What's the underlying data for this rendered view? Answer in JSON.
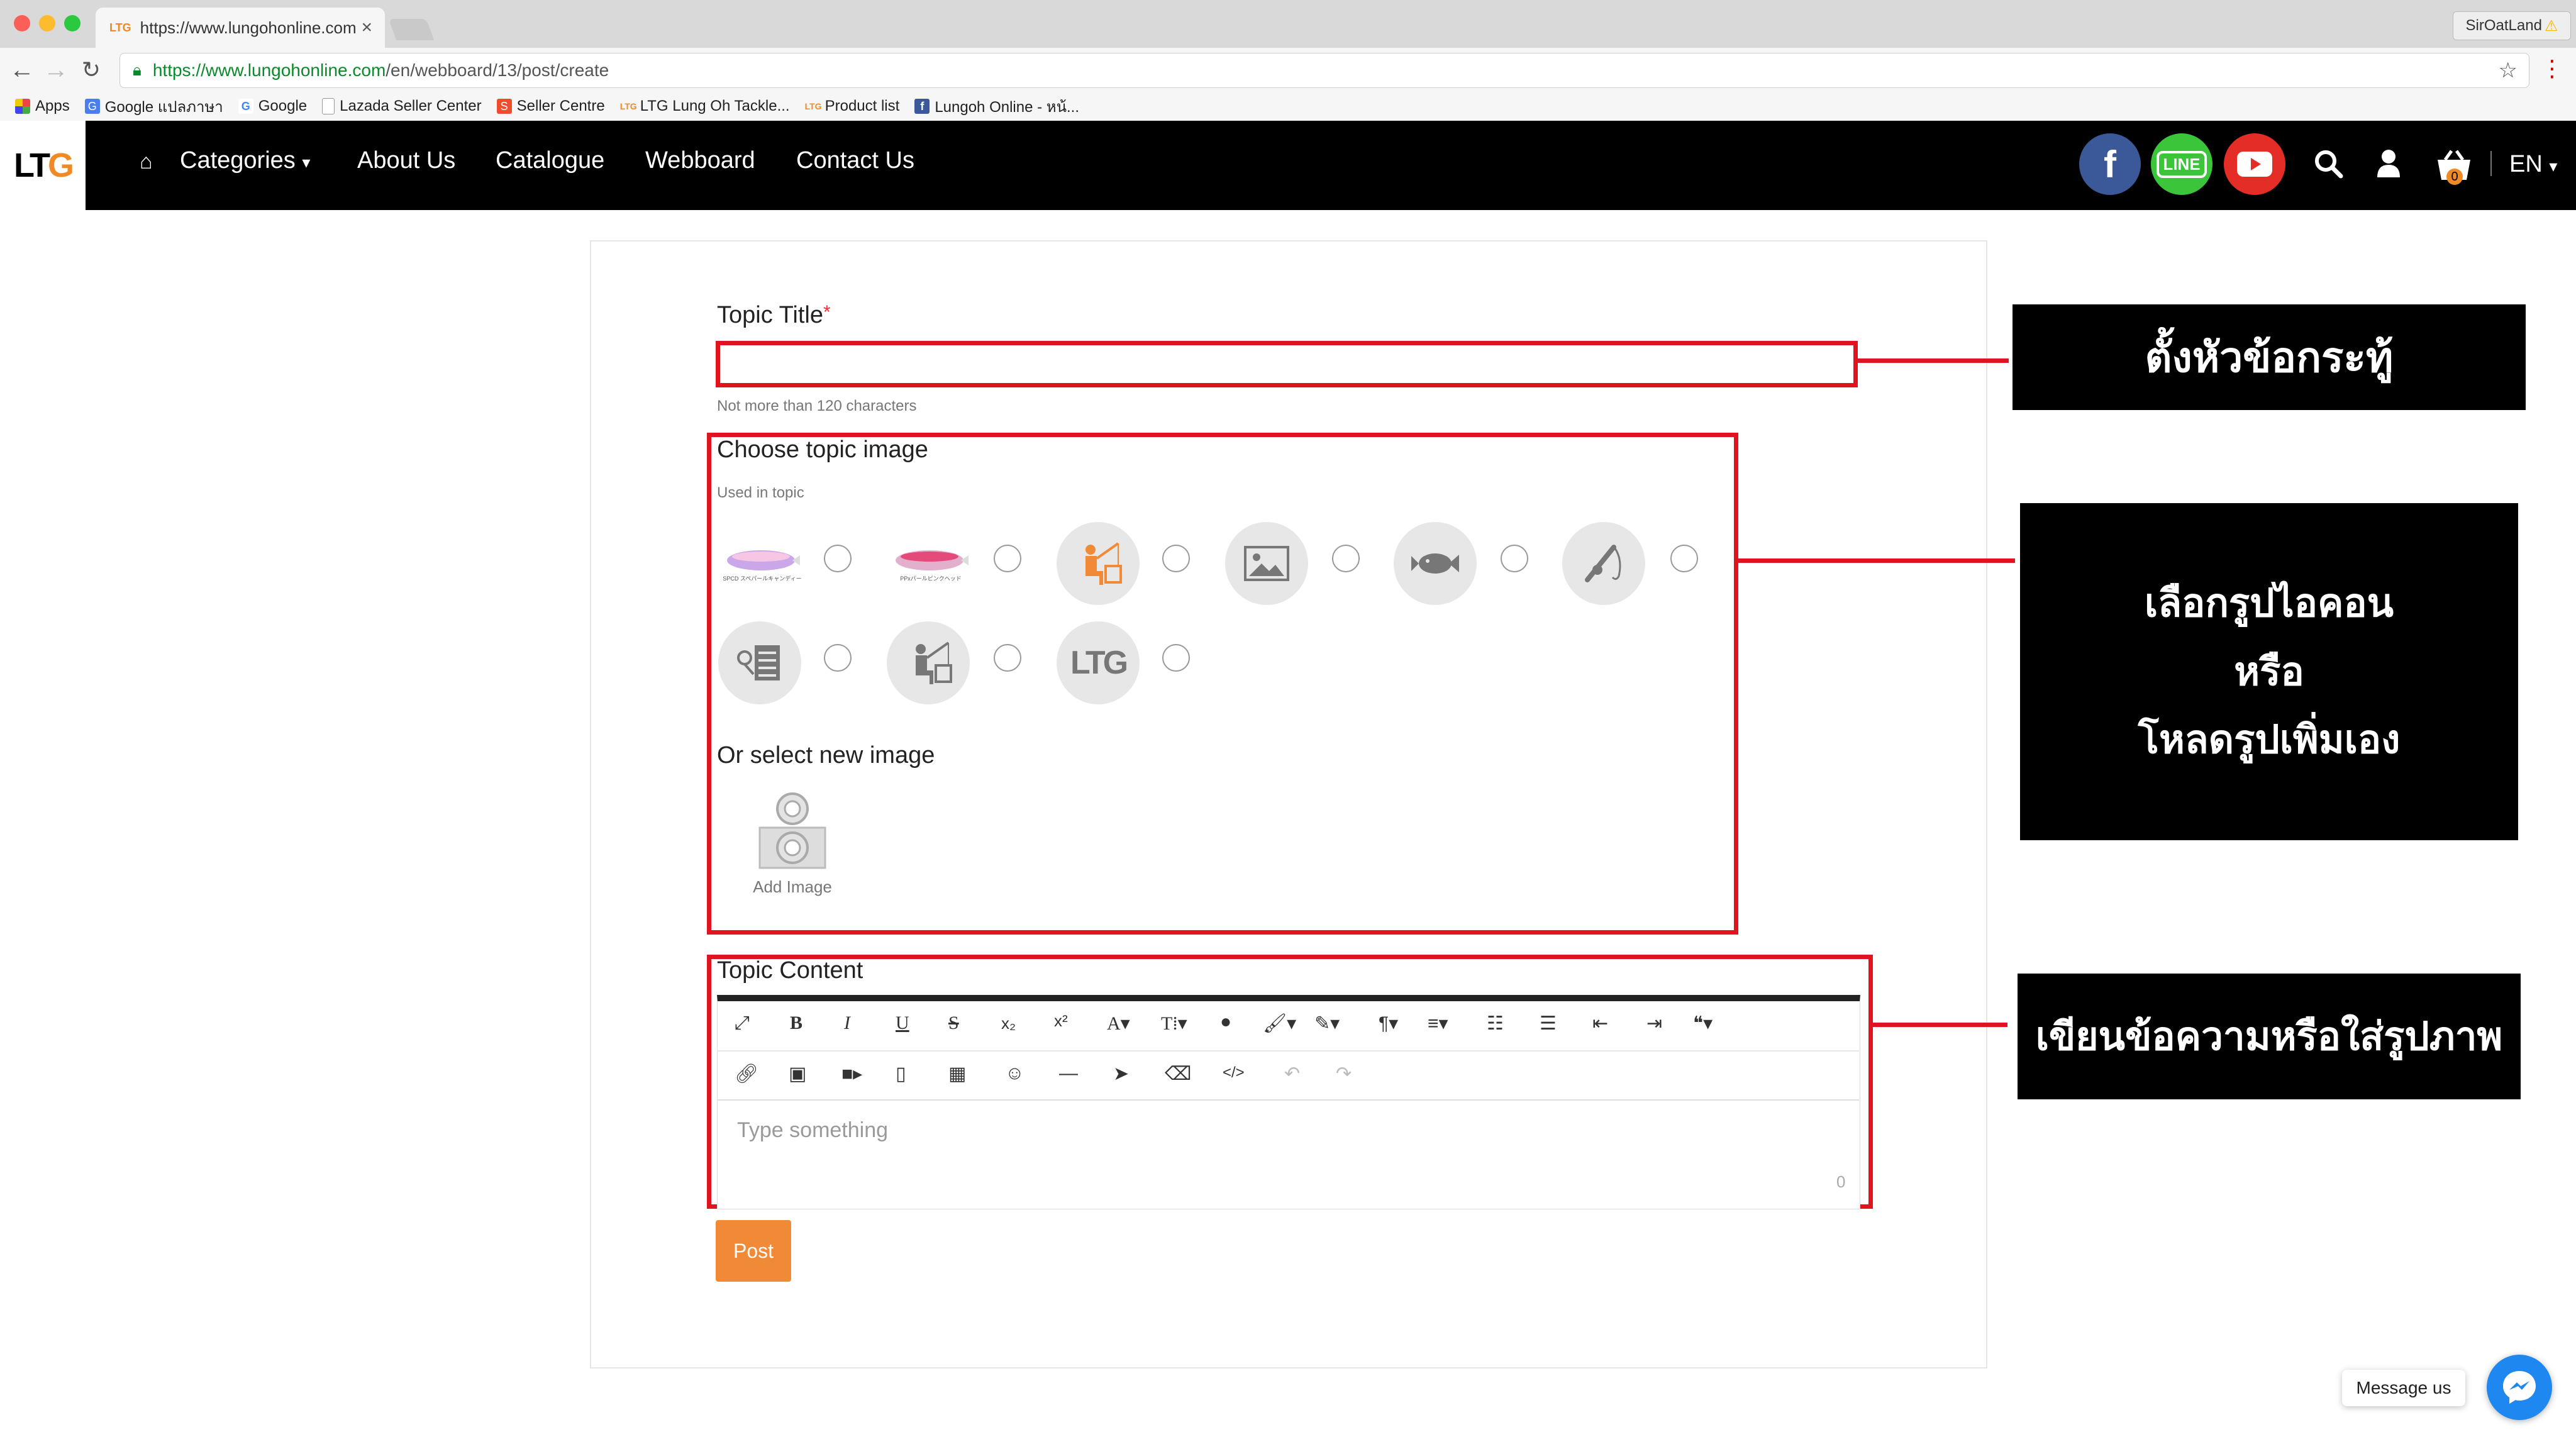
{
  "browser": {
    "tab_title": "https://www.lungohonline.com",
    "tab_favicon": "LTG",
    "profile_name": "SirOatLand",
    "url_host": "https://www.lungohonline.com",
    "url_path": "/en/webboard/13/post/create",
    "bookmarks": [
      {
        "label": "Apps",
        "icon": "apps-grid-icon"
      },
      {
        "label": "Google แปลภาษา",
        "icon": "google-translate-icon"
      },
      {
        "label": "Google",
        "icon": "google-icon"
      },
      {
        "label": "Lazada Seller Center",
        "icon": "page-icon"
      },
      {
        "label": "Seller Centre",
        "icon": "shopee-icon"
      },
      {
        "label": "LTG Lung Oh Tackle...",
        "icon": "ltg-icon"
      },
      {
        "label": "Product list",
        "icon": "ltg-icon"
      },
      {
        "label": "Lungoh Online - หน้...",
        "icon": "facebook-icon"
      }
    ]
  },
  "nav": {
    "logo": "LTG",
    "links": {
      "categories": "Categories",
      "about": "About Us",
      "catalogue": "Catalogue",
      "webboard": "Webboard",
      "contact": "Contact Us"
    },
    "cart_count": "0",
    "language": "EN",
    "colors": {
      "facebook": "#3b5998",
      "line": "#3ac53a",
      "youtube": "#e52d27"
    }
  },
  "form": {
    "title_label": "Topic Title",
    "required_mark": "*",
    "title_hint": "Not more than 120 characters",
    "image_heading": "Choose topic image",
    "image_hint": "Used in topic",
    "topic_images": [
      "lure-pink-icon",
      "lure-red-icon",
      "fisherman-orange-icon",
      "picture-icon",
      "fish-icon",
      "rod-icon",
      "list-icon",
      "fisherman-gray-icon",
      "ltg-logo-icon"
    ],
    "lure_caption_1": "SPCD スペパールキャンディー",
    "lure_caption_2": "PPxパールピンクヘッド",
    "new_image_heading": "Or select new image",
    "add_image_label": "Add Image",
    "content_label": "Topic Content",
    "editor_placeholder": "Type something",
    "editor_char_count": "0",
    "post_button": "Post",
    "accent_color": "#f08a36"
  },
  "annotations": {
    "title_note": "ตั้งหัวข้อกระทู้",
    "image_note_line1": "เลือกรูปไอคอน",
    "image_note_line2": "หรือ",
    "image_note_line3": "โหลดรูปเพิ่มเอง",
    "content_note": "เขียนข้อความหรือใส่รูปภาพ",
    "highlight_color": "#e0141e"
  },
  "messenger": {
    "label": "Message us"
  }
}
